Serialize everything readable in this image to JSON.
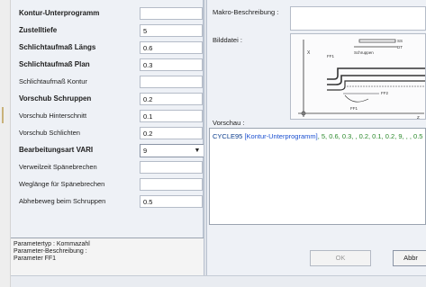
{
  "params": [
    {
      "label": "Kontur-Unterprogramm",
      "value": "",
      "bold": true
    },
    {
      "label": "Zustelltiefe",
      "value": "5",
      "bold": true
    },
    {
      "label": "Schlichtaufmaß Längs",
      "value": "0.6",
      "bold": true
    },
    {
      "label": "Schlichtaufmaß Plan",
      "value": "0.3",
      "bold": true
    },
    {
      "label": "Schlichtaufmaß Kontur",
      "value": "",
      "bold": false
    },
    {
      "label": "Vorschub Schruppen",
      "value": "0.2",
      "bold": true
    },
    {
      "label": "Vorschub Hinterschnitt",
      "value": "0.1",
      "bold": false
    },
    {
      "label": "Vorschub Schlichten",
      "value": "0.2",
      "bold": false
    },
    {
      "label": "Bearbeitungsart VARI",
      "value": "9",
      "bold": true,
      "select": true
    },
    {
      "label": "Verweilzeit Spänebrechen",
      "value": "",
      "bold": false
    },
    {
      "label": "Weglänge für Spänebrechen",
      "value": "",
      "bold": false
    },
    {
      "label": "Abhebeweg beim Schruppen",
      "value": "0.5",
      "bold": false
    }
  ],
  "status": {
    "line1": "Parametertyp : Kommazahl",
    "line2": "Parameter-Beschreibung :",
    "line3": "Parameter FF1"
  },
  "right": {
    "makro_label": "Makro-Beschreibung :",
    "bild_label": "Bilddatei :",
    "vorschau_label": "Vorschau :",
    "diagram": {
      "schruppen": "Schruppen",
      "label_x": "X",
      "label_ff1_top": "FF1",
      "label_ff2": "FF2",
      "label_ff1_bottom": "FF1",
      "label_ss": "SS",
      "label_dt": "DT",
      "label_z": "Z"
    }
  },
  "vorschau": {
    "cycle": "CYCLE95 ",
    "kontur": "[Kontur-Unterprogramm]",
    "values": ", 5, 0.6, 0.3, , 0.2, 0.1, 0.2, 9, , , 0.5"
  },
  "buttons": {
    "ok": "OK",
    "abbrechen": "Abbr"
  },
  "colors": {
    "panel": "#eef1f6",
    "keyword": "#0a3c8c",
    "param_blue": "#1a4fd0",
    "value_green": "#2c8a2c"
  }
}
